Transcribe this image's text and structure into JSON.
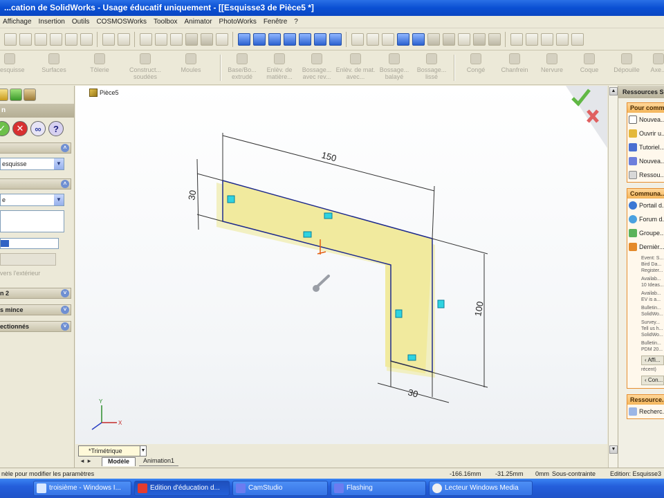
{
  "window": {
    "title": "...cation de SolidWorks - Usage éducatif uniquement - [[Esquisse3 de Pièce5 *]"
  },
  "menu": [
    "Affichage",
    "Insertion",
    "Outils",
    "COSMOSWorks",
    "Toolbox",
    "Animator",
    "PhotoWorks",
    "Fenêtre",
    "?"
  ],
  "features": [
    {
      "label": "...esquisse"
    },
    {
      "label": "Surfaces"
    },
    {
      "label": "Tôlerie"
    },
    {
      "label": "Construct... soudées"
    },
    {
      "label": "Moules"
    },
    {
      "label": "Base/Bo... extrudé"
    },
    {
      "label": "Enlèv. de matière..."
    },
    {
      "label": "Bossage... avec rev..."
    },
    {
      "label": "Enlèv. de mat. avec..."
    },
    {
      "label": "Bossage... balayé"
    },
    {
      "label": "Bossage... lissé"
    },
    {
      "label": "Congé"
    },
    {
      "label": "Chanfrein"
    },
    {
      "label": "Nervure"
    },
    {
      "label": "Coque"
    },
    {
      "label": "Dépouille"
    },
    {
      "label": "Axe..."
    }
  ],
  "property_manager": {
    "header": "n",
    "group1": {
      "title": "",
      "select_value": "esquisse"
    },
    "group2": {
      "title": "",
      "select_value": "e"
    },
    "disabled_text": "vers l'extérieur",
    "group3": "n 2",
    "group4": "s mince",
    "group5": "ectionnés"
  },
  "graphics": {
    "tree_label": "Pièce5",
    "dims": {
      "top": "150",
      "left": "30",
      "right": "100",
      "bottom": "30"
    },
    "view_combo": "*Trimétrique",
    "tab_model": "Modèle",
    "tab_animation": "Animation1",
    "triad_x": "X",
    "triad_y": "Y"
  },
  "task_pane": {
    "title": "Ressources S...",
    "box1_title": "Pour comm...",
    "box1_items": [
      "Nouvea...",
      "Ouvrir u...",
      "Tutoriel...",
      "Nouvea...",
      "Ressou..."
    ],
    "box2_title": "Communa...",
    "box2_items": [
      "Portail d...",
      "Forum d...",
      "Groupe...",
      "Dernièr..."
    ],
    "box2_events": [
      "Event: S...",
      "Bird Da...",
      "Register...",
      "Availab...",
      "10 Ideas...",
      "Availab...",
      "EV is a...",
      "Bulletin...",
      "SolidWo...",
      "Survey...",
      "Tell us h...",
      "SolidWo...",
      "Bulletin...",
      "PDM 20..."
    ],
    "nav_prev": "Affi...",
    "nav_recent": "récent)",
    "nav_next": "Con...",
    "box3_title": "Ressource...",
    "box3_item": "Recherc..."
  },
  "status": {
    "hint": "nèle pour modifier les paramètres",
    "x": "-166.16mm",
    "y": "-31.25mm",
    "z": "0mm",
    "state": "Sous-contrainte",
    "edit": "Edition: Esquisse3"
  },
  "taskbar": [
    {
      "label": "troisième - Windows I..."
    },
    {
      "label": "Edition d'éducation d..."
    },
    {
      "label": "CamStudio"
    },
    {
      "label": "Flashing"
    },
    {
      "label": "Lecteur Windows Media"
    }
  ]
}
